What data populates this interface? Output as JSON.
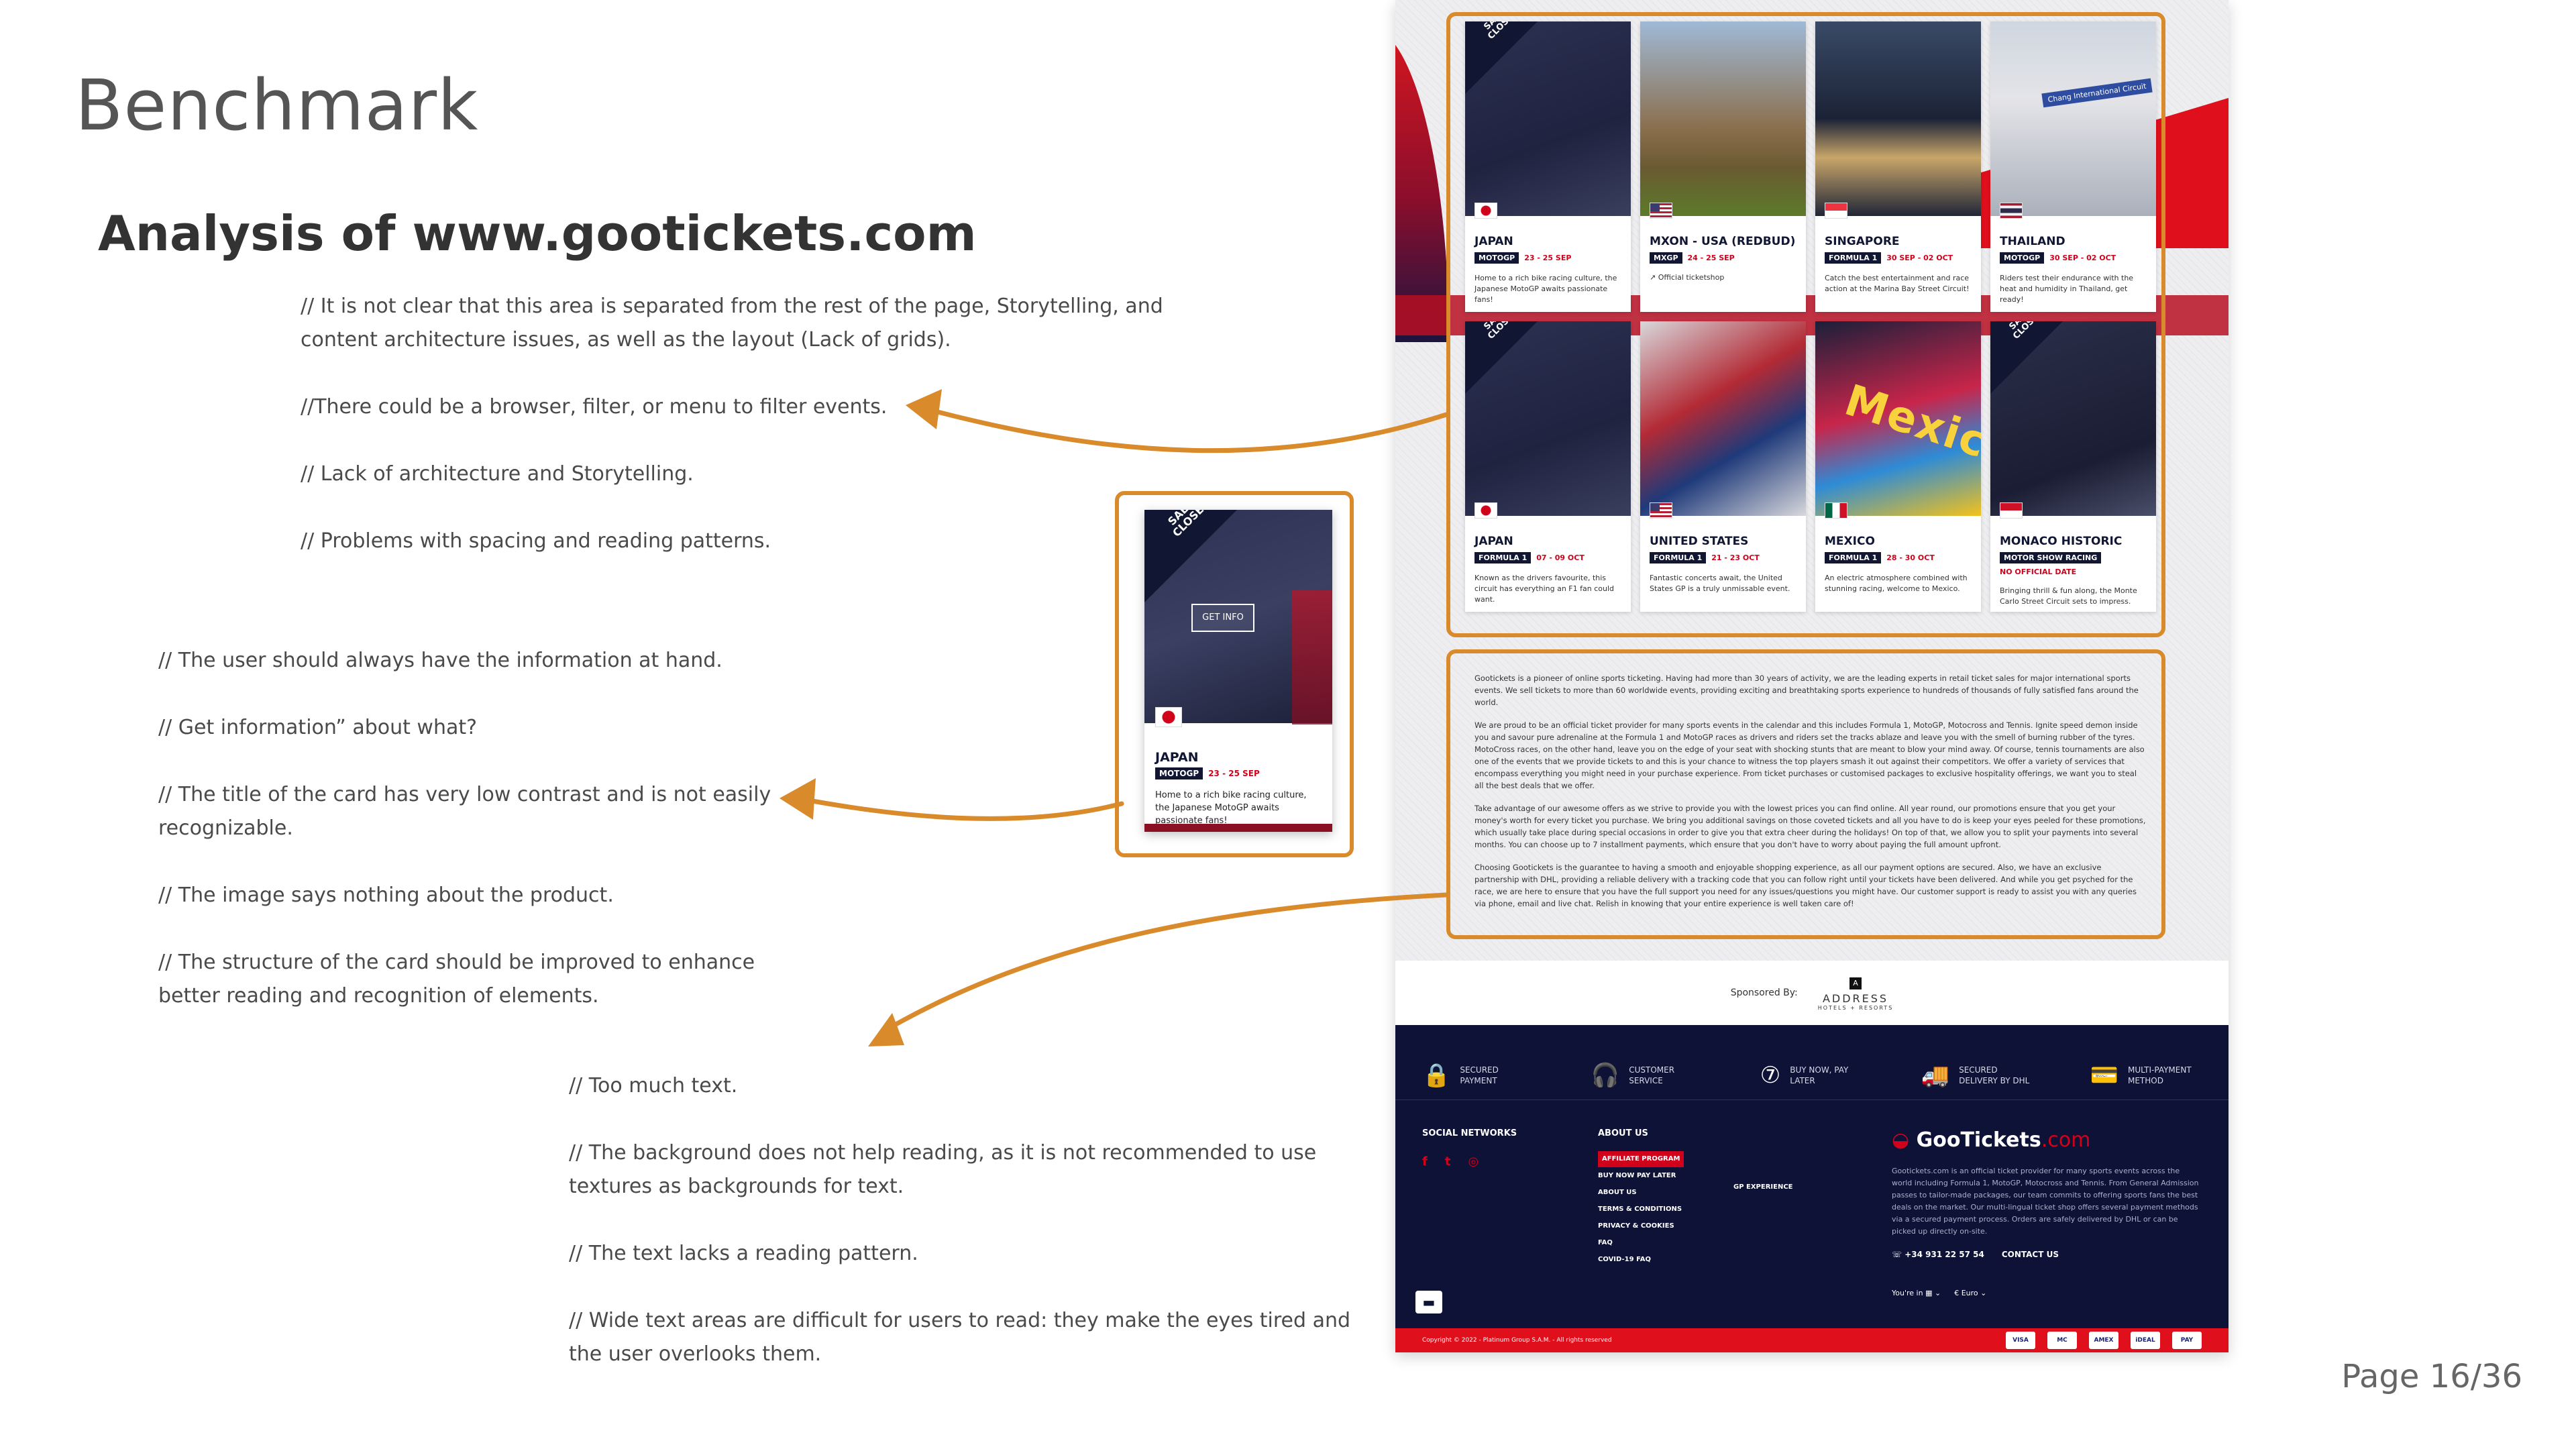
{
  "slide": {
    "title": "Benchmark",
    "subtitle": "Analysis of www.gootickets.com",
    "page_number": "Page 16/36",
    "notes_group_1": [
      "// It is not clear that this area is separated from the rest of the page, Storytelling, and content architecture issues, as well as the layout (Lack of grids).",
      "//There could be a browser, filter, or menu to filter events.",
      "// Lack of architecture and Storytelling.",
      "// Problems with spacing and reading patterns."
    ],
    "notes_group_2": [
      "// The user should always have the information at hand.",
      "// Get information” about what?",
      "// The title of the card has very low contrast and is not easily recognizable.",
      "// The image says nothing about the product.",
      "// The structure of the card should be improved to enhance better reading and recognition of elements."
    ],
    "notes_group_3": [
      "// Too much text.",
      " // The background does not help reading, as it is not recommended to use textures as backgrounds for text.",
      "// The text lacks a reading pattern.",
      "// Wide text areas are difficult for users to read: they make the eyes tired and the user overlooks them."
    ]
  },
  "website": {
    "cards": [
      {
        "name": "JAPAN",
        "series": "MOTOGP",
        "dates": "23 - 25 SEP",
        "desc": "Home to a rich bike racing culture, the Japanese MotoGP awaits passionate fans!",
        "ribbon": "SALES CLOSED",
        "flag": "jp",
        "img": "closed"
      },
      {
        "name": "MXON - USA (REDBUD)",
        "series": "MXGP",
        "dates": "24 - 25 SEP",
        "link": "Official ticketshop",
        "flag": "us",
        "img": "usa"
      },
      {
        "name": "SINGAPORE",
        "series": "FORMULA 1",
        "dates": "30 SEP - 02 OCT",
        "desc": "Catch the best entertainment and race action at the Marina Bay Street Circuit!",
        "flag": "sg",
        "img": "sg"
      },
      {
        "name": "THAILAND",
        "series": "MOTOGP",
        "dates": "30 SEP - 02 OCT",
        "desc": "Riders test their endurance with the heat and humidity in Thailand, get ready!",
        "flag": "th",
        "img": "th",
        "sign": "Chang International Circuit"
      },
      {
        "name": "JAPAN",
        "series": "FORMULA 1",
        "dates": "07 - 09 OCT",
        "desc": "Known as the drivers favourite, this circuit has everything an F1 fan could want.",
        "ribbon": "SALES CLOSED",
        "flag": "jp",
        "img": "closed"
      },
      {
        "name": "UNITED STATES",
        "series": "FORMULA 1",
        "dates": "21 - 23 OCT",
        "desc": "Fantastic concerts await, the United States GP is a truly unmissable event.",
        "flag": "us",
        "img": "usa-track"
      },
      {
        "name": "MEXICO",
        "series": "FORMULA 1",
        "dates": "28 - 30 OCT",
        "desc": "An electric atmosphere combined with stunning racing, welcome to Mexico.",
        "flag": "mx",
        "img": "mx",
        "word": "Mexico"
      },
      {
        "name": "MONACO HISTORIC",
        "series": "MOTOR SHOW RACING",
        "note": "NO OFFICIAL DATE",
        "desc": "Bringing thrill & fun along, the Monte Carlo Street Circuit sets to impress.",
        "ribbon": "SALES CLOSED",
        "flag": "mc",
        "img": "monaco"
      }
    ],
    "about_paragraphs": [
      "Gootickets is a pioneer of online sports ticketing. Having had more than 30 years of activity, we are the leading experts in retail ticket sales for major international sports events. We sell tickets to more than 60 worldwide events, providing exciting and breathtaking sports experience to hundreds of thousands of fully satisfied fans around the world.",
      "We are proud to be an official ticket provider for many sports events in the calendar and this includes Formula 1, MotoGP, Motocross and Tennis. Ignite speed demon inside you and savour pure adrenaline at the Formula 1 and MotoGP races as drivers and riders set the tracks ablaze and leave you with the smell of burning rubber of the tyres. MotoCross races, on the other hand, leave you on the edge of your seat with shocking stunts that are meant to blow your mind away. Of course, tennis tournaments are also one of the events that we provide tickets to and this is your chance to witness the top players smash it out against their competitors. We offer a variety of services that encompass everything you might need in your purchase experience. From ticket purchases or customised packages to exclusive hospitality offerings, we want you to steal all the best deals that we offer.",
      "Take advantage of our awesome offers as we strive to provide you with the lowest prices you can find online. All year round, our promotions ensure that you get your money's worth for every ticket you purchase. We bring you additional savings on those coveted tickets and all you have to do is keep your eyes peeled for these promotions, which usually take place during special occasions in order to give you that extra cheer during the holidays! On top of that, we allow you to split your payments into several months. You can choose up to 7 installment payments, which ensure that you don't have to worry about paying the full amount upfront.",
      "Choosing Gootickets is the guarantee to having a smooth and enjoyable shopping experience, as all our payment options are secured. Also, we have an exclusive partnership with DHL, providing a reliable delivery with a tracking code that you can follow right until your tickets have been delivered. And while you get psyched for the race, we are here to ensure that you have the full support you need for any issues/questions you might have. Our customer support is ready to assist you with any queries via phone, email and live chat. Relish in knowing that your entire experience is well taken care of!"
    ],
    "sponsor": {
      "label": "Sponsored By:",
      "mark": "A",
      "name": "ADDRESS",
      "sub": "HOTELS + RESORTS"
    },
    "features": [
      {
        "icon": "lock-icon",
        "glyph": "🔒",
        "label": "SECURED PAYMENT"
      },
      {
        "icon": "headset-icon",
        "glyph": "🎧",
        "label": "CUSTOMER SERVICE"
      },
      {
        "icon": "installments-icon",
        "glyph": "⑦",
        "label": "BUY NOW, PAY LATER"
      },
      {
        "icon": "truck-icon",
        "glyph": "🚚",
        "label": "SECURED DELIVERY BY DHL"
      },
      {
        "icon": "card-icon",
        "glyph": "💳",
        "label": "MULTI-PAYMENT METHOD"
      }
    ],
    "footer": {
      "social_title": "SOCIAL NETWORKS",
      "social_icons": [
        "f",
        "t",
        "◎"
      ],
      "about_title": "ABOUT US",
      "about_links": [
        "AFFILIATE PROGRAM",
        "BUY NOW PAY LATER",
        "ABOUT US",
        "TERMS & CONDITIONS",
        "PRIVACY & COOKIES",
        "FAQ",
        "COVID-19 FAQ"
      ],
      "gp_experience": "GP EXPERIENCE",
      "brand_main": "GooTickets",
      "brand_suffix": ".com",
      "brand_desc": "Gootickets.com is an official ticket provider for many sports events across the world including Formula 1, MotoGP, Motocross and Tennis. From General Admission passes to tailor-made packages, our team commits to offering sports fans the best deals on the market. Our multi-lingual ticket shop offers several payment methods via a secured payment process. Orders are safely delivered by DHL or can be picked up directly on-site.",
      "phone": "+34 931 22 57 54",
      "contact": "CONTACT US",
      "locale_label": "You're in",
      "currency": "Euro",
      "copyright": "Copyright © 2022 - Platinum Group S.A.M. - All rights reserved",
      "payments": [
        "VISA",
        "MC",
        "AMEX",
        "iDEAL",
        "PAY"
      ]
    }
  },
  "zoom_card": {
    "ribbon": "SALES CLOSED",
    "button": "GET INFO",
    "name": "JAPAN",
    "series": "MOTOGP",
    "dates": "23 - 25 SEP",
    "desc": "Home to a rich bike racing culture, the Japanese MotoGP awaits passionate fans!"
  },
  "colors": {
    "highlight": "#d98a2b",
    "brand_red": "#d0021b",
    "footer_navy": "#0d1236"
  }
}
